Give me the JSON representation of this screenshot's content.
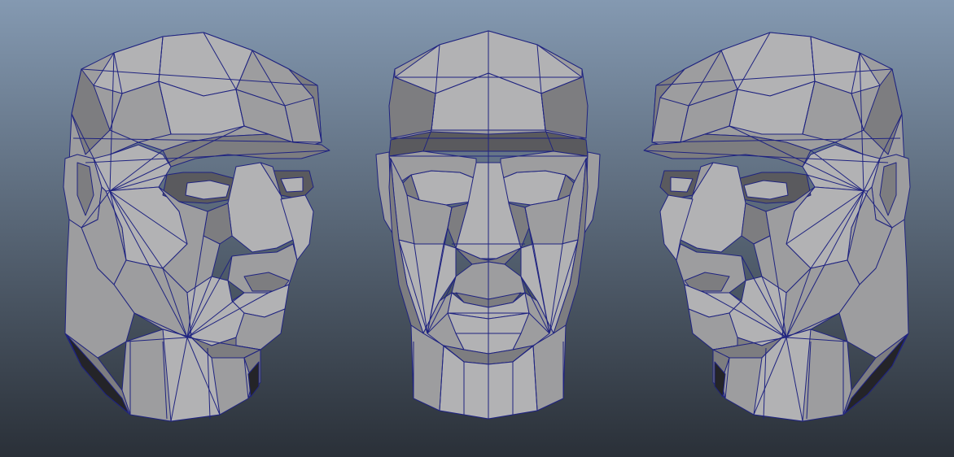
{
  "viewport": {
    "background_top": "#8499b1",
    "background_bottom": "#2a3038",
    "wire_color": "#1f2380",
    "shade_light": "#b2b2b4",
    "shade_mid": "#9d9d9f",
    "shade_dark": "#7d7d80",
    "shade_deep": "#5a5a5e",
    "shade_black": "#242428"
  },
  "models": [
    {
      "name": "head-three-quarter-left"
    },
    {
      "name": "head-front"
    },
    {
      "name": "head-three-quarter-right"
    }
  ]
}
